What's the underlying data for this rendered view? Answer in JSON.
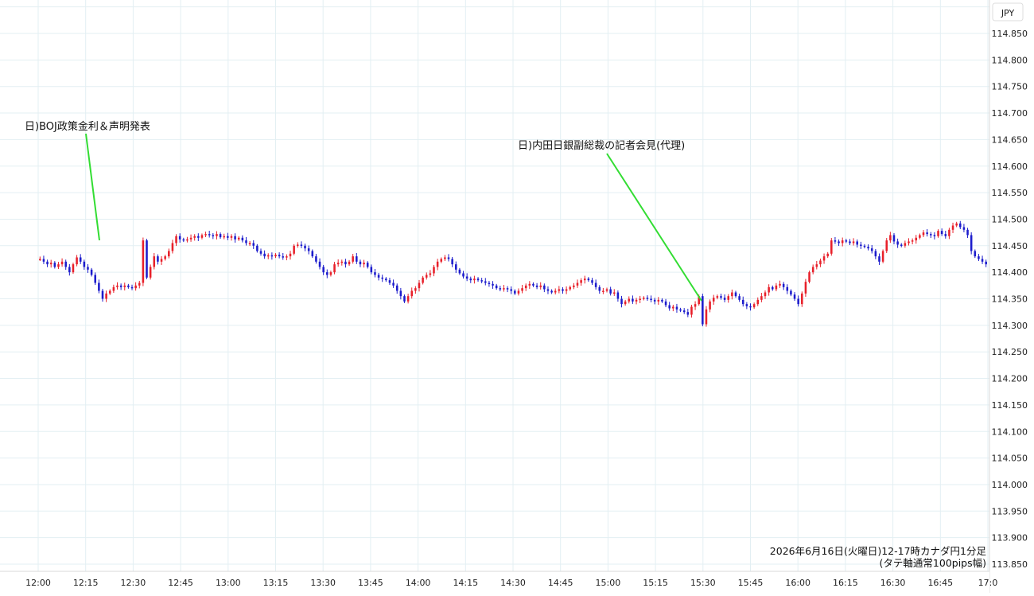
{
  "chart_data": {
    "type": "candlestick",
    "currency_label": "JPY",
    "caption_line1": "2026年6月16日(火曜日)12-17時カナダ円1分足",
    "caption_line2": "(タテ軸通常100pips幅)",
    "ylim": [
      113.85,
      114.85
    ],
    "y_ticks": [
      "114.850",
      "114.800",
      "114.750",
      "114.700",
      "114.650",
      "114.600",
      "114.550",
      "114.500",
      "114.450",
      "114.400",
      "114.350",
      "114.300",
      "114.250",
      "114.200",
      "114.150",
      "114.100",
      "114.050",
      "114.000",
      "113.950",
      "113.900",
      "113.850"
    ],
    "x_ticks": [
      "12:00",
      "12:15",
      "12:30",
      "12:45",
      "13:00",
      "13:15",
      "13:30",
      "13:45",
      "14:00",
      "14:15",
      "14:30",
      "14:45",
      "15:00",
      "15:15",
      "15:30",
      "15:45",
      "16:00",
      "16:15",
      "16:30",
      "16:45",
      "17:0"
    ],
    "annotations": [
      {
        "text": "日)BOJ政策金利＆声明発表"
      },
      {
        "text": "日)内田日銀副総裁の記者会見(代理)"
      }
    ],
    "colors": {
      "up": "#e8202a",
      "down": "#1c1ccc",
      "annotation_line": "#33dd33",
      "grid": "#e3eff3"
    },
    "grid": true,
    "price_path": [
      114.425,
      114.425,
      114.42,
      114.415,
      114.418,
      114.41,
      114.415,
      114.42,
      114.41,
      114.4,
      114.415,
      114.428,
      114.42,
      114.41,
      114.405,
      114.395,
      114.38,
      114.365,
      114.35,
      114.36,
      114.365,
      114.372,
      114.375,
      114.372,
      114.375,
      114.372,
      114.37,
      114.375,
      114.38,
      114.46,
      114.39,
      114.41,
      114.43,
      114.42,
      114.425,
      114.43,
      114.44,
      114.455,
      114.468,
      114.462,
      114.46,
      114.462,
      114.465,
      114.468,
      114.465,
      114.47,
      114.472,
      114.47,
      114.468,
      114.472,
      114.466,
      114.468,
      114.465,
      114.468,
      114.462,
      114.465,
      114.46,
      114.455,
      114.455,
      114.45,
      114.44,
      114.435,
      114.43,
      114.432,
      114.43,
      114.433,
      114.43,
      114.428,
      114.43,
      114.435,
      114.45,
      114.452,
      114.45,
      114.445,
      114.44,
      114.43,
      114.42,
      114.41,
      114.4,
      114.395,
      114.4,
      114.415,
      114.418,
      114.42,
      114.415,
      114.42,
      114.43,
      114.42,
      114.415,
      114.418,
      114.41,
      114.4,
      114.395,
      114.39,
      114.388,
      114.385,
      114.38,
      114.375,
      114.365,
      114.355,
      114.345,
      114.355,
      114.365,
      114.37,
      114.38,
      114.39,
      114.395,
      114.398,
      114.41,
      114.42,
      114.425,
      114.428,
      114.425,
      114.415,
      114.405,
      114.398,
      114.392,
      114.388,
      114.385,
      114.388,
      114.385,
      114.383,
      114.38,
      114.378,
      114.375,
      114.37,
      114.368,
      114.37,
      114.368,
      114.365,
      114.36,
      114.365,
      114.37,
      114.375,
      114.378,
      114.375,
      114.372,
      114.375,
      114.368,
      114.365,
      114.362,
      114.365,
      114.368,
      114.365,
      114.368,
      114.372,
      114.375,
      114.38,
      114.385,
      114.388,
      114.385,
      114.38,
      114.372,
      114.365,
      114.365,
      114.368,
      114.36,
      114.362,
      114.35,
      114.34,
      114.345,
      114.35,
      114.345,
      114.348,
      114.35,
      114.352,
      114.35,
      114.348,
      114.345,
      114.348,
      114.345,
      114.338,
      114.332,
      114.335,
      114.33,
      114.328,
      114.325,
      114.32,
      114.335,
      114.34,
      114.355,
      114.302,
      114.33,
      114.345,
      114.352,
      114.355,
      114.352,
      114.348,
      114.355,
      114.362,
      114.355,
      114.348,
      114.34,
      114.336,
      114.334,
      114.34,
      114.348,
      114.355,
      114.362,
      114.372,
      114.368,
      114.375,
      114.378,
      114.372,
      114.365,
      114.358,
      114.35,
      114.34,
      114.36,
      114.382,
      114.4,
      114.41,
      114.415,
      114.422,
      114.43,
      114.435,
      114.46,
      114.458,
      114.455,
      114.46,
      114.458,
      114.455,
      114.458,
      114.452,
      114.45,
      114.448,
      114.445,
      114.44,
      114.43,
      114.42,
      114.44,
      114.46,
      114.47,
      114.458,
      114.452,
      114.45,
      114.455,
      114.458,
      114.46,
      114.465,
      114.47,
      114.475,
      114.472,
      114.47,
      114.468,
      114.478,
      114.472,
      114.468,
      114.48,
      114.488,
      114.492,
      114.485,
      114.48,
      114.47,
      114.44,
      114.43,
      114.425,
      114.42,
      114.415
    ]
  }
}
